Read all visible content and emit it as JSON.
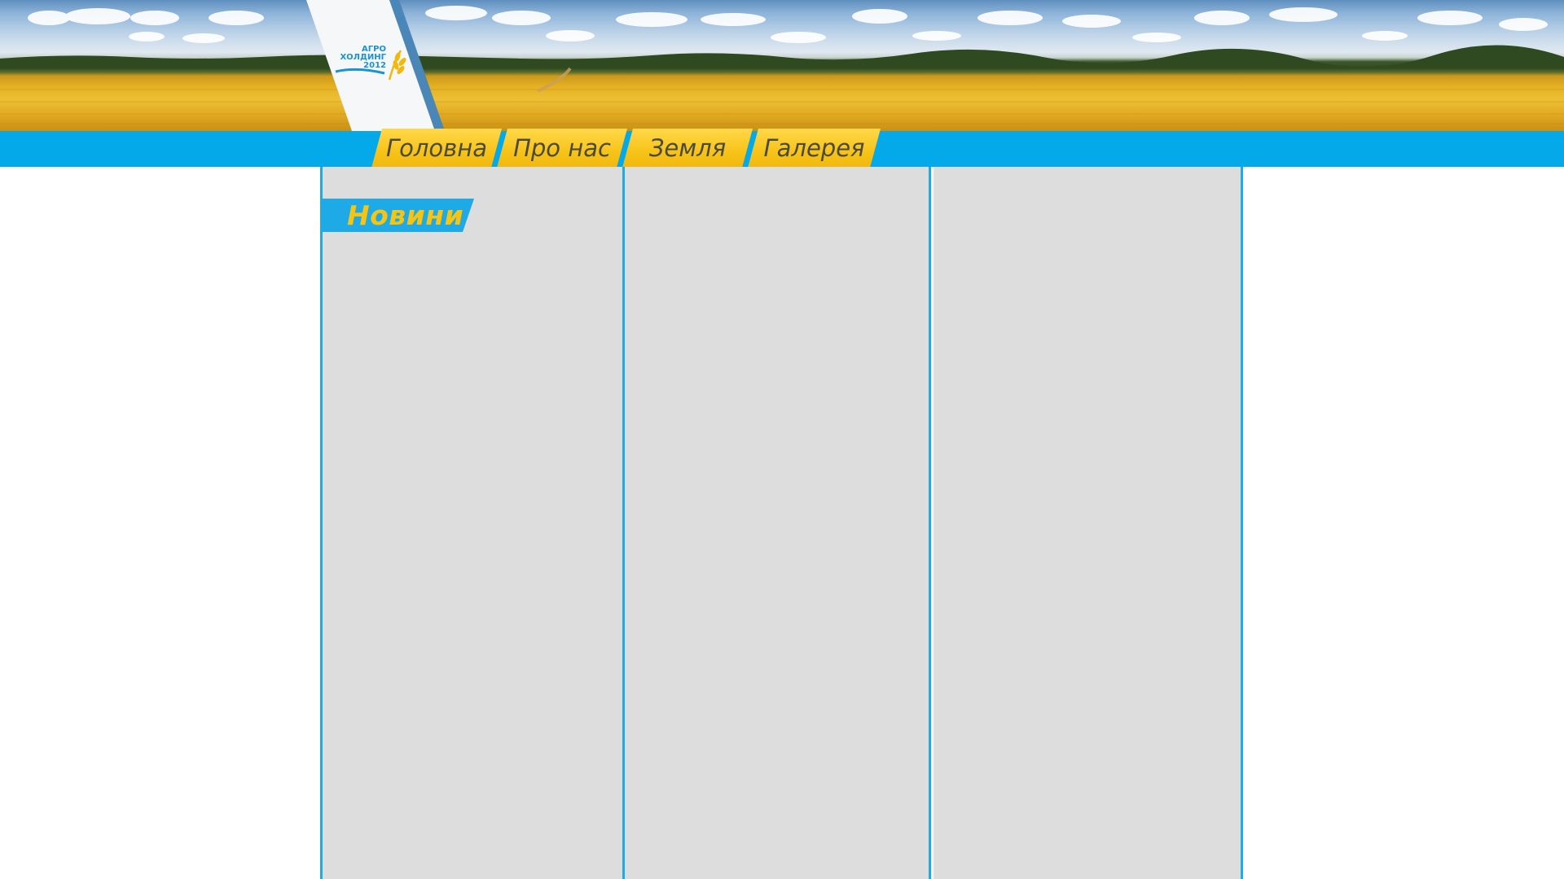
{
  "header": {
    "logo": {
      "lines": [
        "АГРО",
        "ХОЛДИНГ",
        "2012"
      ]
    }
  },
  "nav": {
    "items": [
      {
        "label": "Головна"
      },
      {
        "label": "Про нас"
      },
      {
        "label": "Земля"
      },
      {
        "label": "Галерея"
      }
    ]
  },
  "sidebar": {
    "news_title": "Новини"
  },
  "colors": {
    "accent_blue": "#03a9e9",
    "accent_yellow": "#f7c318",
    "column_bg": "#dddddd",
    "news_title_text": "#f6c412",
    "nav_text": "#4a4a3f"
  }
}
